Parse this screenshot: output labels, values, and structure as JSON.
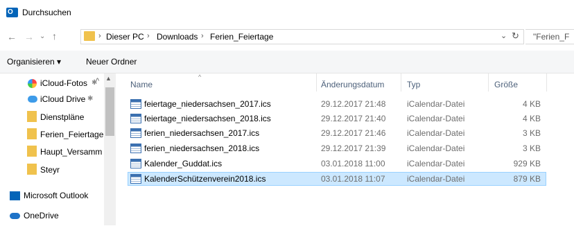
{
  "window": {
    "title": "Durchsuchen"
  },
  "address": {
    "crumbs": [
      "Dieser PC",
      "Downloads",
      "Ferien_Feiertage"
    ],
    "separator": "›",
    "search_text": "\"Ferien_F"
  },
  "toolbar": {
    "organize_label": "Organisieren ▾",
    "new_folder_label": "Neuer Ordner"
  },
  "nav": {
    "items": [
      {
        "label": "iCloud-Fotos",
        "pin": "✱",
        "icon": "photos-icon"
      },
      {
        "label": "iCloud Drive",
        "pin": "✱",
        "icon": "cloud-icon"
      },
      {
        "label": "Dienstpläne",
        "icon": "folder-icon"
      },
      {
        "label": "Ferien_Feiertage",
        "icon": "folder-icon"
      },
      {
        "label": "Haupt_Versamm",
        "icon": "folder-icon"
      },
      {
        "label": "Steyr",
        "icon": "folder-icon"
      },
      {
        "label": "Microsoft Outlook",
        "icon": "outlook-icon"
      },
      {
        "label": "OneDrive",
        "icon": "onedrive-icon"
      }
    ]
  },
  "list": {
    "columns": {
      "name": "Name",
      "date": "Änderungsdatum",
      "type": "Typ",
      "size": "Größe"
    },
    "rows": [
      {
        "name": "feiertage_niedersachsen_2017.ics",
        "date": "29.12.2017 21:48",
        "type": "iCalendar-Datei",
        "size": "4 KB"
      },
      {
        "name": "feiertage_niedersachsen_2018.ics",
        "date": "29.12.2017 21:40",
        "type": "iCalendar-Datei",
        "size": "4 KB"
      },
      {
        "name": "ferien_niedersachsen_2017.ics",
        "date": "29.12.2017 21:46",
        "type": "iCalendar-Datei",
        "size": "3 KB"
      },
      {
        "name": "ferien_niedersachsen_2018.ics",
        "date": "29.12.2017 21:39",
        "type": "iCalendar-Datei",
        "size": "3 KB"
      },
      {
        "name": "Kalender_Guddat.ics",
        "date": "03.01.2018 11:00",
        "type": "iCalendar-Datei",
        "size": "929 KB"
      },
      {
        "name": "KalenderSchützenverein2018.ics",
        "date": "03.01.2018 11:07",
        "type": "iCalendar-Datei",
        "size": "879 KB",
        "selected": true
      }
    ]
  },
  "colors": {
    "accent": "#0364b8",
    "selection": "#cce8ff",
    "folder": "#f0c24d"
  }
}
